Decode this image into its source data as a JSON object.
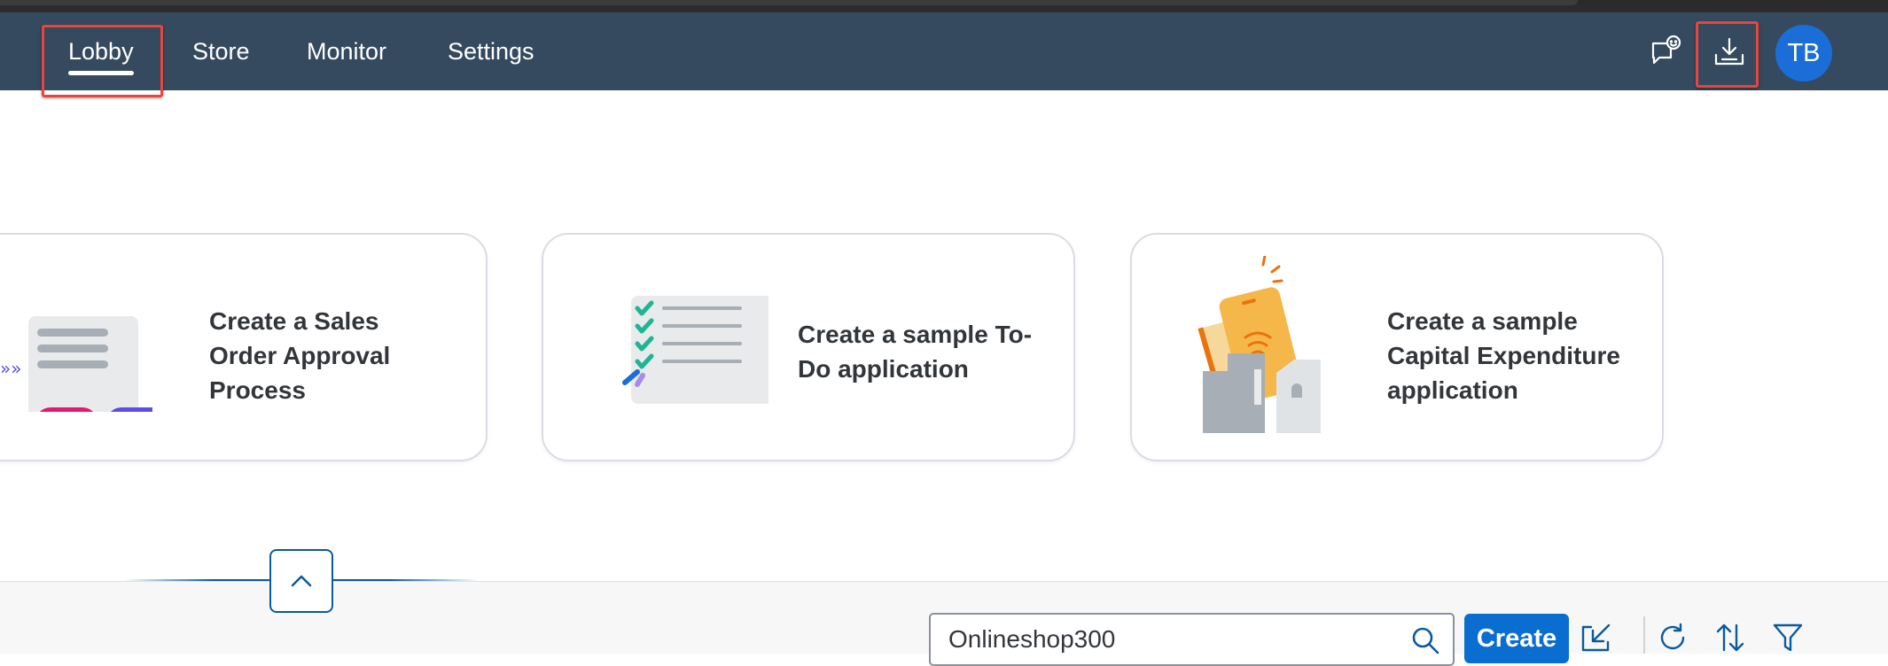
{
  "shellbar": {
    "tabs": [
      {
        "label": "Lobby",
        "active": true
      },
      {
        "label": "Store",
        "active": false
      },
      {
        "label": "Monitor",
        "active": false
      },
      {
        "label": "Settings",
        "active": false
      }
    ],
    "icons": [
      "feedback-icon",
      "download-icon"
    ],
    "avatar_initials": "TB"
  },
  "cards": [
    {
      "title_lines": [
        "Create a Sales",
        "Order Approval",
        "Process"
      ],
      "illustration": "sales-order-approval-illustration"
    },
    {
      "title_lines": [
        "Create a sample To-",
        "Do application"
      ],
      "illustration": "todo-checklist-illustration"
    },
    {
      "title_lines": [
        "Create a sample",
        "Capital Expenditure",
        "application"
      ],
      "illustration": "capital-expenditure-illustration"
    }
  ],
  "bottom_toolbar": {
    "search_value": "Onlineshop300",
    "create_label": "Create",
    "icons": [
      "import-icon",
      "refresh-icon",
      "sort-icon",
      "filter-icon"
    ]
  },
  "colors": {
    "shellbar_bg": "#354a5f",
    "accent_blue": "#0a6ed1",
    "highlight_red": "#e8453c",
    "avatar_blue": "#1b6ed8"
  }
}
